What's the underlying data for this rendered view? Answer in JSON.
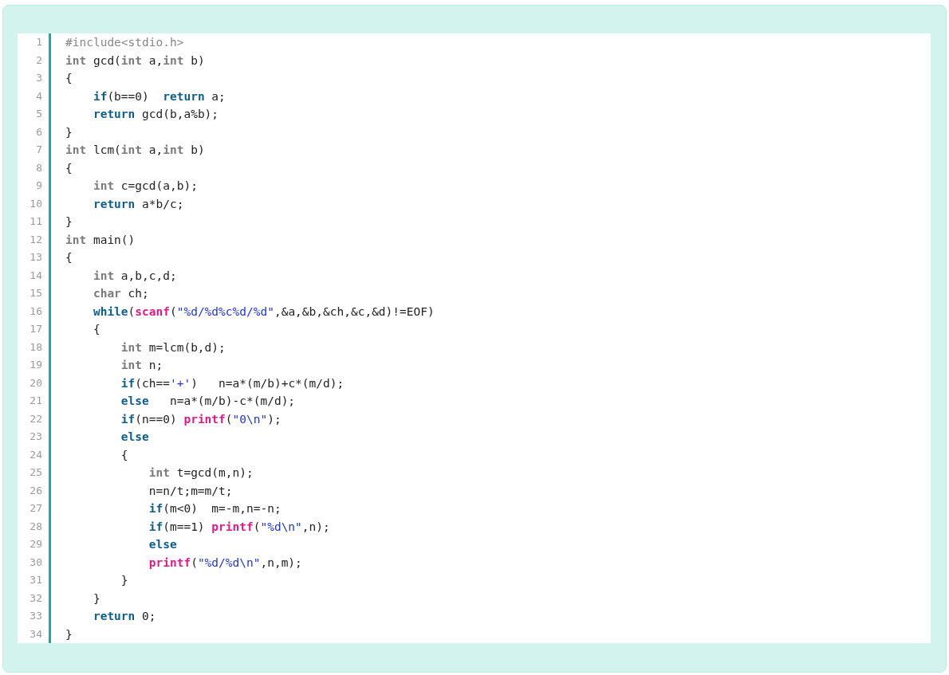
{
  "code_lines": [
    {
      "number": "1",
      "tokens": [
        {
          "kind": "pre",
          "text": "#include<stdio.h>"
        }
      ]
    },
    {
      "number": "2",
      "tokens": [
        {
          "kind": "type",
          "text": "int"
        },
        {
          "kind": "plain",
          "text": " gcd("
        },
        {
          "kind": "type",
          "text": "int"
        },
        {
          "kind": "plain",
          "text": " a,"
        },
        {
          "kind": "type",
          "text": "int"
        },
        {
          "kind": "plain",
          "text": " b)"
        }
      ]
    },
    {
      "number": "3",
      "tokens": [
        {
          "kind": "plain",
          "text": "{"
        }
      ]
    },
    {
      "number": "4",
      "tokens": [
        {
          "kind": "keyword",
          "text": "    if"
        },
        {
          "kind": "plain",
          "text": "(b==0)  "
        },
        {
          "kind": "keyword",
          "text": "return"
        },
        {
          "kind": "plain",
          "text": " a;"
        }
      ]
    },
    {
      "number": "5",
      "tokens": [
        {
          "kind": "keyword",
          "text": "    return"
        },
        {
          "kind": "plain",
          "text": " gcd(b,a%b);"
        }
      ]
    },
    {
      "number": "6",
      "tokens": [
        {
          "kind": "plain",
          "text": "}"
        }
      ]
    },
    {
      "number": "7",
      "tokens": [
        {
          "kind": "type",
          "text": "int"
        },
        {
          "kind": "plain",
          "text": " lcm("
        },
        {
          "kind": "type",
          "text": "int"
        },
        {
          "kind": "plain",
          "text": " a,"
        },
        {
          "kind": "type",
          "text": "int"
        },
        {
          "kind": "plain",
          "text": " b)"
        }
      ]
    },
    {
      "number": "8",
      "tokens": [
        {
          "kind": "plain",
          "text": "{"
        }
      ]
    },
    {
      "number": "9",
      "tokens": [
        {
          "kind": "type",
          "text": "    int"
        },
        {
          "kind": "plain",
          "text": " c=gcd(a,b);"
        }
      ]
    },
    {
      "number": "10",
      "tokens": [
        {
          "kind": "keyword",
          "text": "    return"
        },
        {
          "kind": "plain",
          "text": " a*b/c;"
        }
      ]
    },
    {
      "number": "11",
      "tokens": [
        {
          "kind": "plain",
          "text": "}"
        }
      ]
    },
    {
      "number": "12",
      "tokens": [
        {
          "kind": "type",
          "text": "int"
        },
        {
          "kind": "plain",
          "text": " main()"
        }
      ]
    },
    {
      "number": "13",
      "tokens": [
        {
          "kind": "plain",
          "text": "{"
        }
      ]
    },
    {
      "number": "14",
      "tokens": [
        {
          "kind": "type",
          "text": "    int"
        },
        {
          "kind": "plain",
          "text": " a,b,c,d;"
        }
      ]
    },
    {
      "number": "15",
      "tokens": [
        {
          "kind": "type",
          "text": "    char"
        },
        {
          "kind": "plain",
          "text": " ch;"
        }
      ]
    },
    {
      "number": "16",
      "tokens": [
        {
          "kind": "keyword",
          "text": "    while"
        },
        {
          "kind": "plain",
          "text": "("
        },
        {
          "kind": "func",
          "text": "scanf"
        },
        {
          "kind": "plain",
          "text": "("
        },
        {
          "kind": "string",
          "text": "\"%d/%d%c%d/%d\""
        },
        {
          "kind": "plain",
          "text": ",&a,&b,&ch,&c,&d)!=EOF)"
        }
      ]
    },
    {
      "number": "17",
      "tokens": [
        {
          "kind": "plain",
          "text": "    {"
        }
      ]
    },
    {
      "number": "18",
      "tokens": [
        {
          "kind": "type",
          "text": "        int"
        },
        {
          "kind": "plain",
          "text": " m=lcm(b,d);"
        }
      ]
    },
    {
      "number": "19",
      "tokens": [
        {
          "kind": "type",
          "text": "        int"
        },
        {
          "kind": "plain",
          "text": " n;"
        }
      ]
    },
    {
      "number": "20",
      "tokens": [
        {
          "kind": "keyword",
          "text": "        if"
        },
        {
          "kind": "plain",
          "text": "(ch=="
        },
        {
          "kind": "string",
          "text": "'+'"
        },
        {
          "kind": "plain",
          "text": ")   n=a*(m/b)+c*(m/d);"
        }
      ]
    },
    {
      "number": "21",
      "tokens": [
        {
          "kind": "keyword",
          "text": "        else"
        },
        {
          "kind": "plain",
          "text": "   n=a*(m/b)-c*(m/d);"
        }
      ]
    },
    {
      "number": "22",
      "tokens": [
        {
          "kind": "keyword",
          "text": "        if"
        },
        {
          "kind": "plain",
          "text": "(n==0) "
        },
        {
          "kind": "func",
          "text": "printf"
        },
        {
          "kind": "plain",
          "text": "("
        },
        {
          "kind": "string",
          "text": "\"0\\n\""
        },
        {
          "kind": "plain",
          "text": ");"
        }
      ]
    },
    {
      "number": "23",
      "tokens": [
        {
          "kind": "keyword",
          "text": "        else"
        }
      ]
    },
    {
      "number": "24",
      "tokens": [
        {
          "kind": "plain",
          "text": "        {"
        }
      ]
    },
    {
      "number": "25",
      "tokens": [
        {
          "kind": "type",
          "text": "            int"
        },
        {
          "kind": "plain",
          "text": " t=gcd(m,n);"
        }
      ]
    },
    {
      "number": "26",
      "tokens": [
        {
          "kind": "plain",
          "text": "            n=n/t;m=m/t;"
        }
      ]
    },
    {
      "number": "27",
      "tokens": [
        {
          "kind": "keyword",
          "text": "            if"
        },
        {
          "kind": "plain",
          "text": "(m<0)  m=-m,n=-n;"
        }
      ]
    },
    {
      "number": "28",
      "tokens": [
        {
          "kind": "keyword",
          "text": "            if"
        },
        {
          "kind": "plain",
          "text": "(m==1) "
        },
        {
          "kind": "func",
          "text": "printf"
        },
        {
          "kind": "plain",
          "text": "("
        },
        {
          "kind": "string",
          "text": "\"%d\\n\""
        },
        {
          "kind": "plain",
          "text": ",n);"
        }
      ]
    },
    {
      "number": "29",
      "tokens": [
        {
          "kind": "keyword",
          "text": "            else"
        }
      ]
    },
    {
      "number": "30",
      "tokens": [
        {
          "kind": "func",
          "text": "            printf"
        },
        {
          "kind": "plain",
          "text": "("
        },
        {
          "kind": "string",
          "text": "\"%d/%d\\n\""
        },
        {
          "kind": "plain",
          "text": ",n,m);"
        }
      ]
    },
    {
      "number": "31",
      "tokens": [
        {
          "kind": "plain",
          "text": "        }"
        }
      ]
    },
    {
      "number": "32",
      "tokens": [
        {
          "kind": "plain",
          "text": "    }"
        }
      ]
    },
    {
      "number": "33",
      "tokens": [
        {
          "kind": "keyword",
          "text": "    return"
        },
        {
          "kind": "plain",
          "text": " 0;"
        }
      ]
    },
    {
      "number": "34",
      "tokens": [
        {
          "kind": "plain",
          "text": "}"
        }
      ]
    }
  ]
}
